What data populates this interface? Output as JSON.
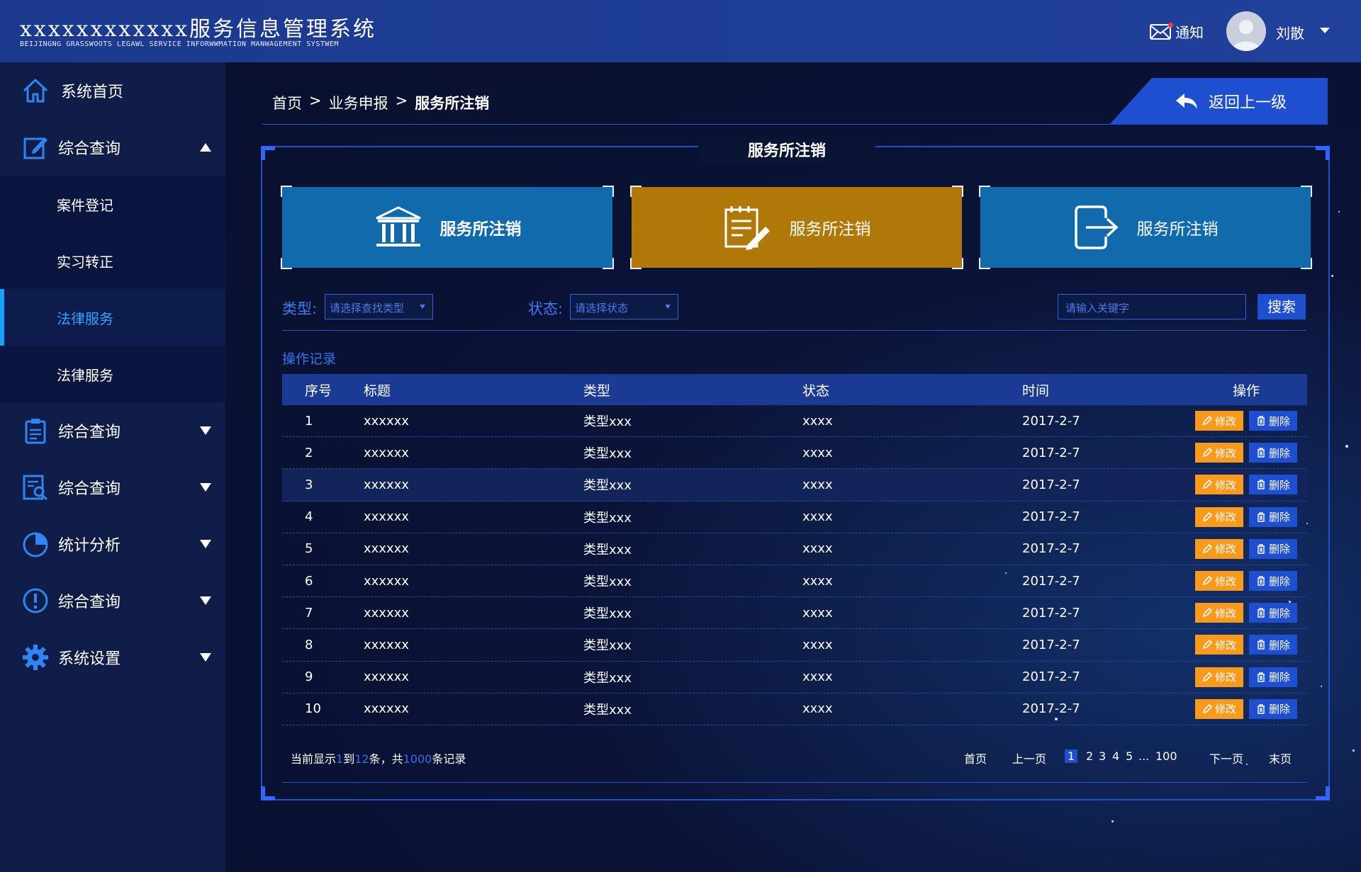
{
  "header": {
    "title": "xxxxxxxxxxxx服务信息管理系统",
    "subtitle": "BEIJINGNG GRASSWOOTS LEGAWL SERVICE INFORWWMATION MANWAGEMENT SYSTWEM",
    "notice_label": "通知",
    "username": "刘散"
  },
  "sidebar": {
    "items": [
      {
        "label": "系统首页",
        "icon": "home-icon"
      },
      {
        "label": "综合查询",
        "icon": "edit-icon",
        "expanded": true
      },
      {
        "label": "案件登记"
      },
      {
        "label": "实习转正"
      },
      {
        "label": "法律服务",
        "active": true
      },
      {
        "label": "法律服务"
      },
      {
        "label": "综合查询",
        "icon": "clipboard-icon"
      },
      {
        "label": "综合查询",
        "icon": "search-doc-icon"
      },
      {
        "label": "统计分析",
        "icon": "pie-chart-icon"
      },
      {
        "label": "综合查询",
        "icon": "alert-icon"
      },
      {
        "label": "系统设置",
        "icon": "gear-icon"
      }
    ]
  },
  "breadcrumb": {
    "home": "首页",
    "sep1": ">",
    "level1": "业务申报",
    "sep2": ">",
    "current": "服务所注销"
  },
  "back_button": "返回上一级",
  "panel_title": "服务所注销",
  "cards": [
    {
      "label": "服务所注销",
      "color": "#116aab",
      "icon": "bank-icon"
    },
    {
      "label": "服务所注销",
      "color": "#b07808",
      "icon": "edit-doc-icon"
    },
    {
      "label": "服务所注销",
      "color": "#116aab",
      "icon": "logout-icon"
    }
  ],
  "filters": {
    "type_label": "类型:",
    "type_placeholder": "请选择查找类型",
    "status_label": "状态:",
    "status_placeholder": "请选择状态",
    "keyword_placeholder": "请输入关键字",
    "search_button": "搜索"
  },
  "section_title": "操作记录",
  "table": {
    "headers": [
      "序号",
      "标题",
      "类型",
      "状态",
      "时间",
      "操作"
    ],
    "edit_label": "修改",
    "delete_label": "删除",
    "rows": [
      {
        "no": "1",
        "title": "xxxxxx",
        "type": "类型xxx",
        "status": "xxxx",
        "time": "2017-2-7"
      },
      {
        "no": "2",
        "title": "xxxxxx",
        "type": "类型xxx",
        "status": "xxxx",
        "time": "2017-2-7"
      },
      {
        "no": "3",
        "title": "xxxxxx",
        "type": "类型xxx",
        "status": "xxxx",
        "time": "2017-2-7"
      },
      {
        "no": "4",
        "title": "xxxxxx",
        "type": "类型xxx",
        "status": "xxxx",
        "time": "2017-2-7"
      },
      {
        "no": "5",
        "title": "xxxxxx",
        "type": "类型xxx",
        "status": "xxxx",
        "time": "2017-2-7"
      },
      {
        "no": "6",
        "title": "xxxxxx",
        "type": "类型xxx",
        "status": "xxxx",
        "time": "2017-2-7"
      },
      {
        "no": "7",
        "title": "xxxxxx",
        "type": "类型xxx",
        "status": "xxxx",
        "time": "2017-2-7"
      },
      {
        "no": "8",
        "title": "xxxxxx",
        "type": "类型xxx",
        "status": "xxxx",
        "time": "2017-2-7"
      },
      {
        "no": "9",
        "title": "xxxxxx",
        "type": "类型xxx",
        "status": "xxxx",
        "time": "2017-2-7"
      },
      {
        "no": "10",
        "title": "xxxxxx",
        "type": "类型xxx",
        "status": "xxxx",
        "time": "2017-2-7"
      }
    ]
  },
  "footer": {
    "info_prefix": "当前显示",
    "info_from": "1",
    "info_to_label": "到",
    "info_to": "12",
    "info_mid": "条，共",
    "info_total": "1000",
    "info_suffix": "条记录",
    "first": "首页",
    "prev": "上一页",
    "pages": [
      "1",
      "2",
      "3",
      "4",
      "5",
      "...",
      "100"
    ],
    "current_page": "1",
    "next": "下一页",
    "last": "末页"
  }
}
